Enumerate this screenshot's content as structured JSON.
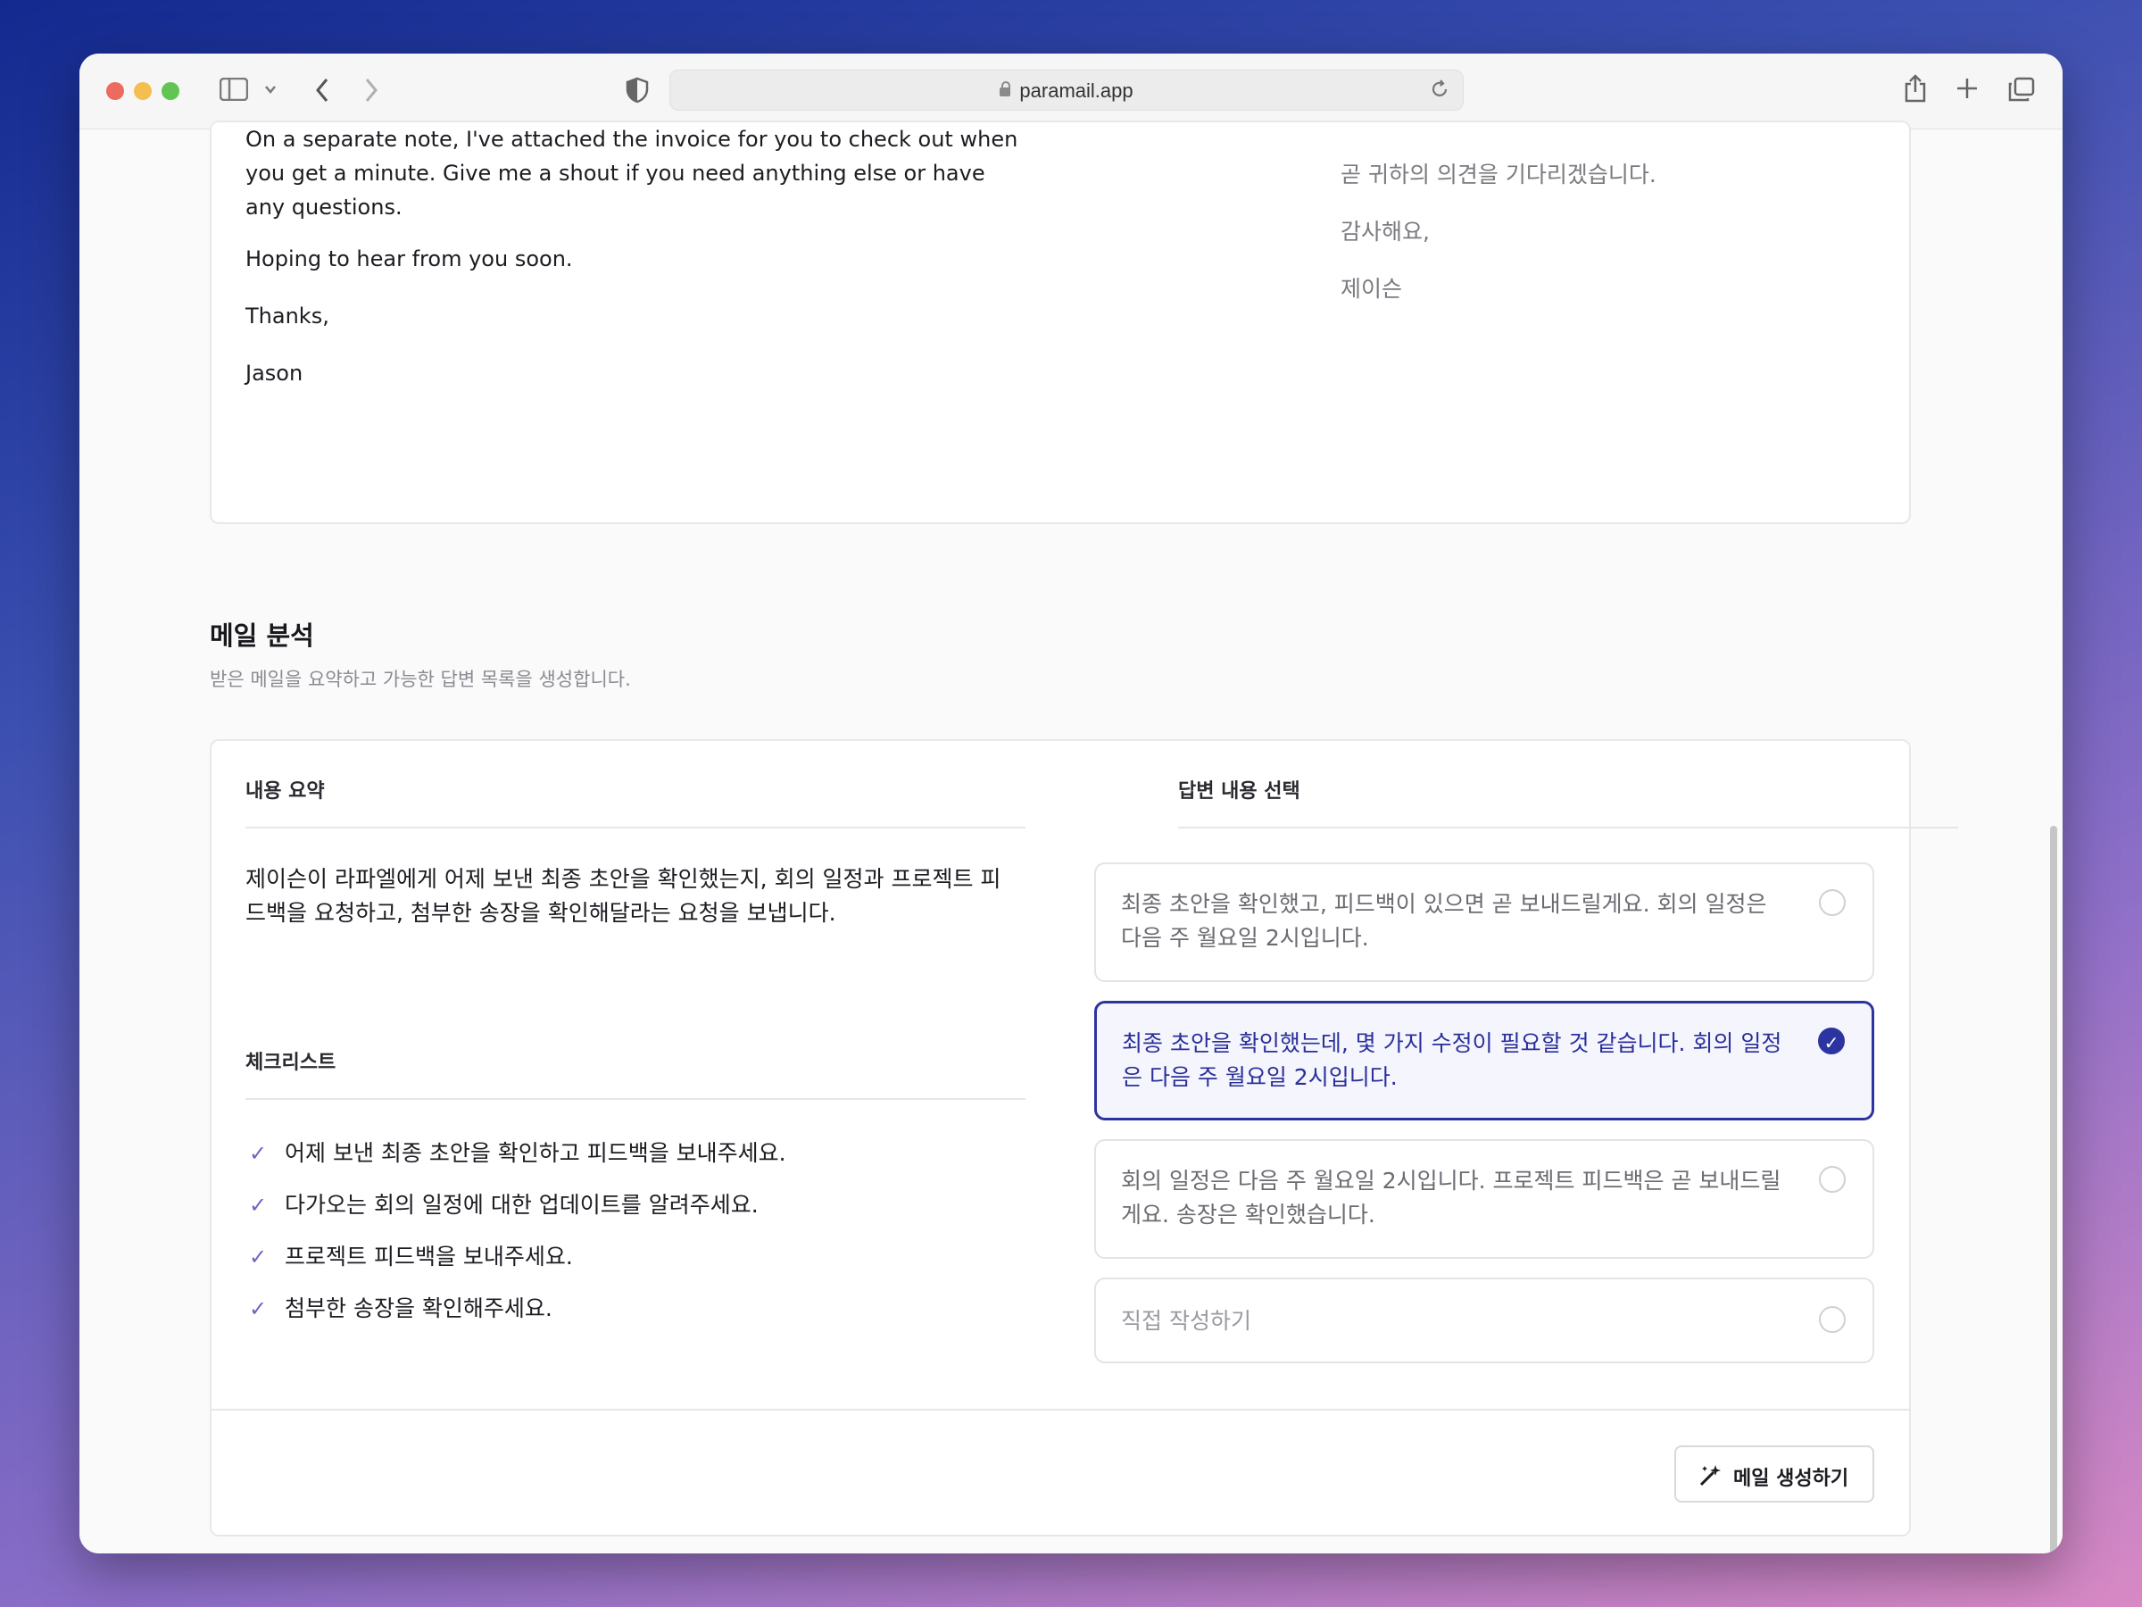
{
  "browser": {
    "url": "paramail.app"
  },
  "email_en": {
    "paragraph": "On a separate note, I've attached the invoice for you to check out when you get a minute. Give me a shout if you need anything else or have any questions.",
    "closing1": "Hoping to hear from you soon.",
    "closing2": "Thanks,",
    "signature": "Jason"
  },
  "email_ko": {
    "line1": "곧 귀하의 의견을 기다리겠습니다.",
    "line2": "감사해요,",
    "line3": "제이슨"
  },
  "analysis": {
    "title": "메일 분석",
    "subtitle": "받은 메일을 요약하고 가능한 답변 목록을 생성합니다.",
    "summary_label": "내용 요약",
    "summary_text": "제이슨이 라파엘에게 어제 보낸 최종 초안을 확인했는지, 회의 일정과 프로젝트 피드백을 요청하고, 첨부한 송장을 확인해달라는 요청을 보냅니다.",
    "checklist_label": "체크리스트",
    "checklist": [
      "어제 보낸 최종 초안을 확인하고 피드백을 보내주세요.",
      "다가오는 회의 일정에 대한 업데이트를 알려주세요.",
      "프로젝트 피드백을 보내주세요.",
      "첨부한 송장을 확인해주세요."
    ],
    "reply_label": "답변 내용 선택",
    "options": [
      "최종 초안을 확인했고, 피드백이 있으면 곧 보내드릴게요. 회의 일정은 다음 주 월요일 2시입니다.",
      "최종 초안을 확인했는데, 몇 가지 수정이 필요할 것 같습니다. 회의 일정은 다음 주 월요일 2시입니다.",
      "회의 일정은 다음 주 월요일 2시입니다. 프로젝트 피드백은 곧 보내드릴게요. 송장은 확인했습니다.",
      "직접 작성하기"
    ],
    "selected_index": 1,
    "generate_button": "메일 생성하기"
  },
  "colors": {
    "accent": "#2c34a0",
    "check": "#6b66c4"
  }
}
